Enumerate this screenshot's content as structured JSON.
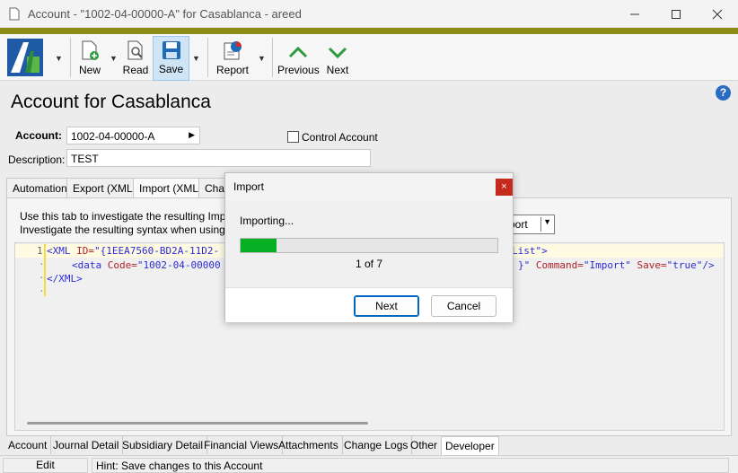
{
  "window": {
    "title": "Account - \"1002-04-00000-A\" for Casablanca - areed"
  },
  "toolbar": {
    "new_label": "New",
    "read_label": "Read",
    "save_label": "Save",
    "report_label": "Report",
    "previous_label": "Previous",
    "next_label": "Next"
  },
  "page": {
    "title": "Account for Casablanca",
    "help": "?"
  },
  "form": {
    "account_label": "Account:",
    "account_value": "1002-04-00000-A",
    "control_account_label": "Control Account",
    "description_label": "Description:",
    "description_value": "TEST"
  },
  "tabs_top": [
    "Automation",
    "Export (XML)",
    "Import (XML)",
    "Chan"
  ],
  "panel": {
    "info_line1": "Use this tab to investigate the resulting Import",
    "info_line2": "Investigate the resulting syntax when using Da",
    "combo_value": "port"
  },
  "code": {
    "line1_num": "1",
    "line1_open": "<XML ",
    "line1_attr": "ID=",
    "line1_val": "\"{1EEA7560-BD2A-11D2-",
    "line1_tail": "List\">",
    "line2_open": "<data ",
    "line2_attr": "Code=",
    "line2_val": "\"1002-04-00000",
    "line2_tail_brace": "}\"",
    "line2_attr2": " Command=",
    "line2_val2": "\"Import\"",
    "line2_attr3": " Save=",
    "line2_val3": "\"true\"",
    "line2_close": "/>",
    "line3": "</XML>"
  },
  "tabs_bottom": [
    "Account",
    "Journal Detail",
    "Subsidiary Detail",
    "Financial Views",
    "Attachments",
    "Change Logs",
    "Other",
    "Developer"
  ],
  "status": {
    "mode": "Edit",
    "hint": "Hint:  Save changes to this Account"
  },
  "dialog": {
    "title": "Import",
    "close": "×",
    "importing": "Importing...",
    "progress": 0.14,
    "count": "1 of 7",
    "next_button": "Next",
    "cancel_button": "Cancel"
  },
  "colors": {
    "accent_strip": "#8c8c17",
    "progress": "#06b025",
    "close_red": "#c42b1c",
    "arrow_green": "#2e9a3e"
  }
}
